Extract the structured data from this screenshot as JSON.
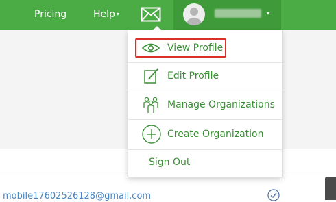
{
  "nav": {
    "pricing_label": "Pricing",
    "help_label": "Help",
    "help_caret": "▾",
    "profile_caret": "▾"
  },
  "dropdown": {
    "items": [
      {
        "label": "View Profile",
        "icon": "eye-icon",
        "highlighted": true
      },
      {
        "label": "Edit Profile",
        "icon": "edit-icon"
      },
      {
        "label": "Manage Organizations",
        "icon": "people-icon"
      },
      {
        "label": "Create Organization",
        "icon": "plus-circle-icon"
      },
      {
        "label": "Sign Out"
      }
    ]
  },
  "content": {
    "email": "mobile17602526128@gmail.com"
  },
  "colors": {
    "brand_green": "#4bac46",
    "profile_green": "#3f9b3a",
    "menu_text": "#3b8f35",
    "highlight_red": "#d9312a",
    "link_blue": "#4a86c5"
  }
}
